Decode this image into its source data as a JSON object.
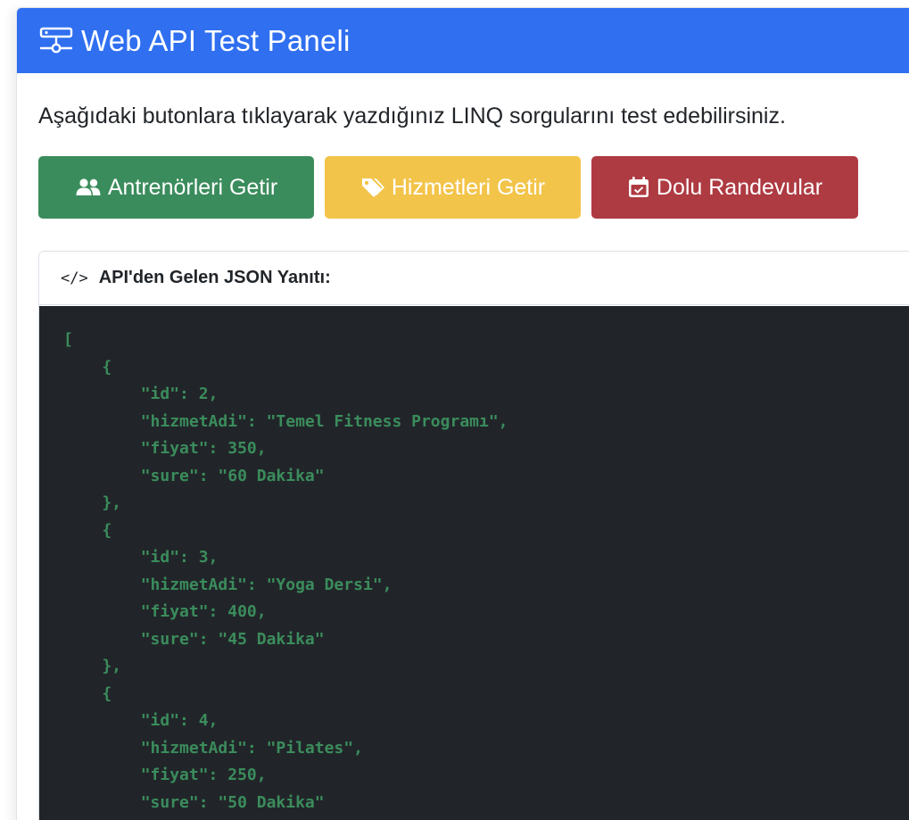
{
  "header": {
    "title": "Web API Test Paneli",
    "icon": "network-icon"
  },
  "intro": {
    "text": "Aşağıdaki butonlara tıklayarak yazdığınız LINQ sorgularını test edebilirsiniz."
  },
  "buttons": [
    {
      "label": "Antrenörleri Getir",
      "icon": "users-icon",
      "color": "#3b8c5c"
    },
    {
      "label": "Hizmetleri Getir",
      "icon": "tag-icon",
      "color": "#f3c44a"
    },
    {
      "label": "Dolu Randevular",
      "icon": "calendar-check-icon",
      "color": "#ae3a42"
    }
  ],
  "response": {
    "title": "API'den Gelen JSON Yanıtı:",
    "icon": "code-icon",
    "json": "[\n    {\n        \"id\": 2,\n        \"hizmetAdi\": \"Temel Fitness Programı\",\n        \"fiyat\": 350,\n        \"sure\": \"60 Dakika\"\n    },\n    {\n        \"id\": 3,\n        \"hizmetAdi\": \"Yoga Dersi\",\n        \"fiyat\": 400,\n        \"sure\": \"45 Dakika\"\n    },\n    {\n        \"id\": 4,\n        \"hizmetAdi\": \"Pilates\",\n        \"fiyat\": 250,\n        \"sure\": \"50 Dakika\""
  },
  "colors": {
    "header_bg": "#2f6ff0",
    "code_bg": "#212529",
    "code_text": "#3b8c5c"
  }
}
